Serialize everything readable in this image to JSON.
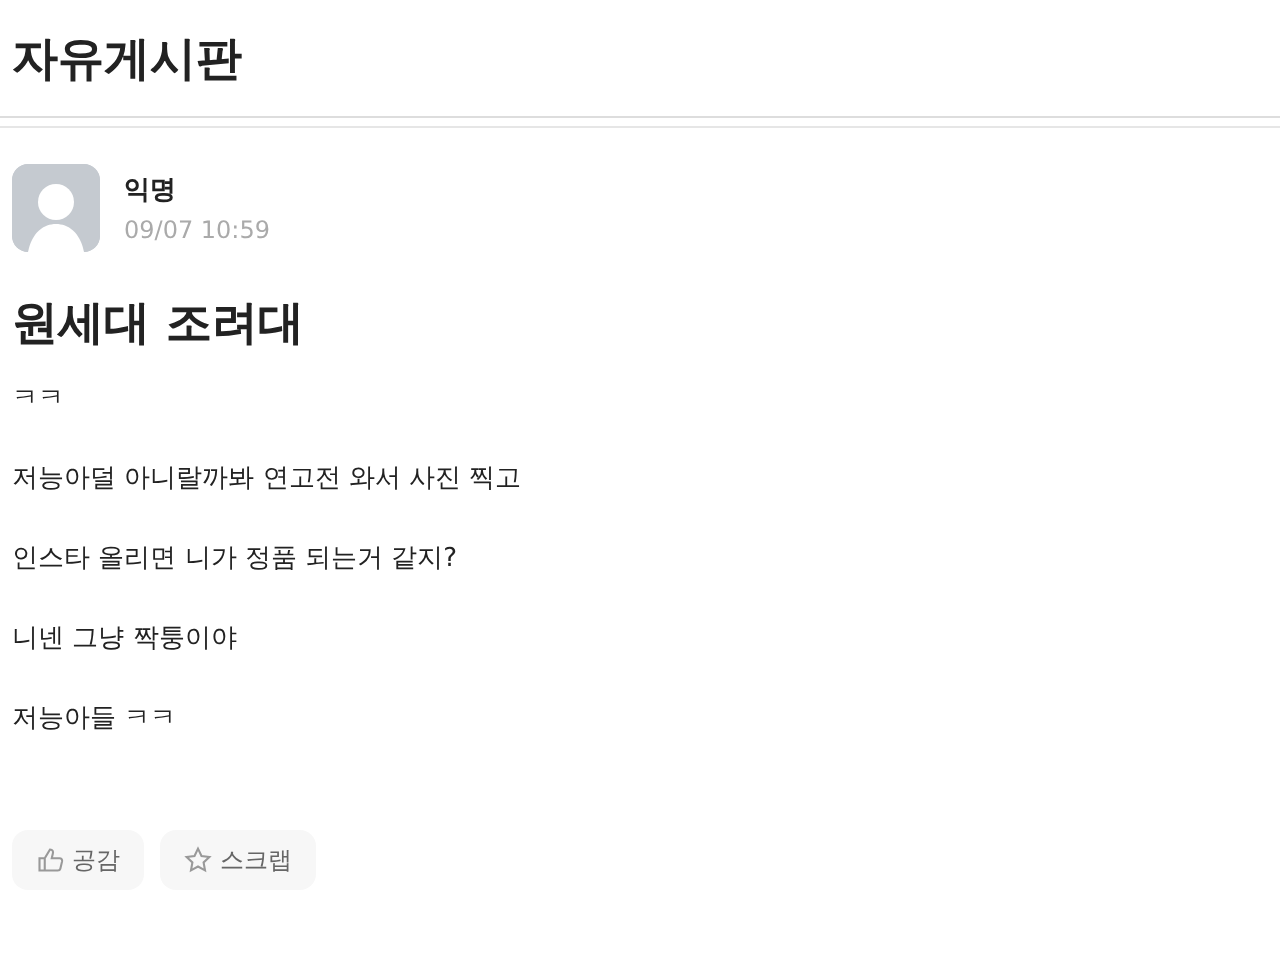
{
  "board": {
    "title": "자유게시판"
  },
  "post": {
    "author": "익명",
    "time": "09/07 10:59",
    "title": "원세대 조려대",
    "paragraphs": [
      "ㅋㅋ",
      "저능아덜 아니랄까봐 연고전 와서 사진 찍고",
      "인스타 올리면 니가 정품 되는거 같지?",
      "니넨 그냥 짝퉁이야",
      "저능아들 ㅋㅋ"
    ],
    "actions": [
      {
        "kind": "like",
        "label": "공감"
      },
      {
        "kind": "scrap",
        "label": "스크랩"
      }
    ]
  }
}
